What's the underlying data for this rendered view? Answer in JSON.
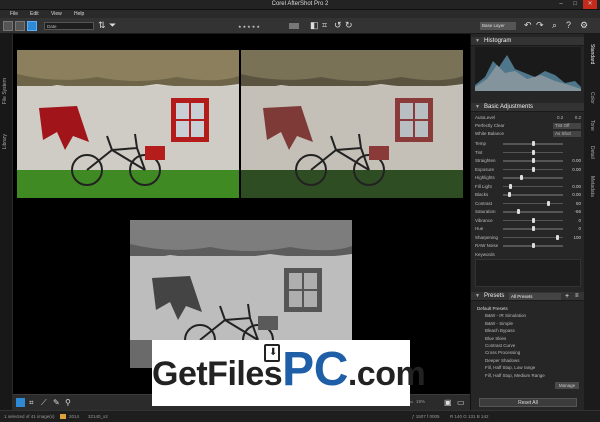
{
  "window": {
    "title": "Corel AfterShot Pro 2",
    "min": "–",
    "max": "□",
    "close": "✕"
  },
  "menu": [
    "File",
    "Edit",
    "View",
    "Help"
  ],
  "toolbar": {
    "sort_select": "Date",
    "layer_select": "Base Layer"
  },
  "left_tabs": [
    "File System",
    "Library"
  ],
  "right_tabs": [
    "Standard",
    "Color",
    "Tone",
    "Detail",
    "Metadata"
  ],
  "histogram": {
    "title": "Histogram"
  },
  "basic": {
    "title": "Basic Adjustments",
    "auto_level": "AutoLevel",
    "auto_vals": [
      "0.2",
      "0.2"
    ],
    "perfectly_clear": "Perfectly Clear",
    "pc_select": "Tint Off",
    "white_balance": "White Balance",
    "wb_select": "As Shot",
    "sliders": [
      {
        "label": "Temp",
        "value": "",
        "pos": 0.5
      },
      {
        "label": "Tint",
        "value": "",
        "pos": 0.5
      },
      {
        "label": "Straighten",
        "value": "0.00",
        "pos": 0.5
      },
      {
        "label": "Exposure",
        "value": "0.00",
        "pos": 0.5
      },
      {
        "label": "Highlights",
        "value": "",
        "pos": 0.3
      },
      {
        "label": "Fill Light",
        "value": "0.00",
        "pos": 0.12
      },
      {
        "label": "Blacks",
        "value": "0.00",
        "pos": 0.1
      },
      {
        "label": "Contrast",
        "value": "50",
        "pos": 0.75
      },
      {
        "label": "Saturation",
        "value": "-66",
        "pos": 0.25
      },
      {
        "label": "Vibrance",
        "value": "0",
        "pos": 0.5
      },
      {
        "label": "Hue",
        "value": "0",
        "pos": 0.5
      },
      {
        "label": "Sharpening",
        "value": "100",
        "pos": 0.9
      },
      {
        "label": "RAW Noise",
        "value": "",
        "pos": 0.5
      }
    ],
    "keywords_label": "Keywords"
  },
  "presets": {
    "title": "Presets",
    "filter": "All Presets",
    "items": [
      "Default Presets",
      "B&W - IR Simulation",
      "B&W - Simple",
      "Bleach Bypass",
      "Blue Skies",
      "Contrast Curve",
      "Cross Processing",
      "Deeper Shadows",
      "Fill, Half Stop, Low range",
      "Fill, Half Stop, Medium Range"
    ],
    "manage": "Manage",
    "reset": "Reset All"
  },
  "status": {
    "selection": "1 selected of 41 image(s)",
    "folder1": "2014",
    "folder2": "32140_x2",
    "info": "ƒ 1507  f 0005",
    "pixel": "R   140   G   131   B   142",
    "zoom": "19%"
  },
  "watermark": {
    "part1": "GetFiles",
    "part2": "PC",
    "part3": ".com"
  },
  "colors": {
    "accent": "#2f8ad6",
    "watermark_blue": "#1e5fa8",
    "watermark_dark": "#222222"
  },
  "icons": [
    "grid-view-icon",
    "single-view-icon",
    "compare-view-icon",
    "rotate-left-icon",
    "rotate-right-icon",
    "undo-icon",
    "redo-icon",
    "crop-icon",
    "brush-icon",
    "dropper-icon",
    "search-icon",
    "help-icon",
    "settings-icon"
  ]
}
